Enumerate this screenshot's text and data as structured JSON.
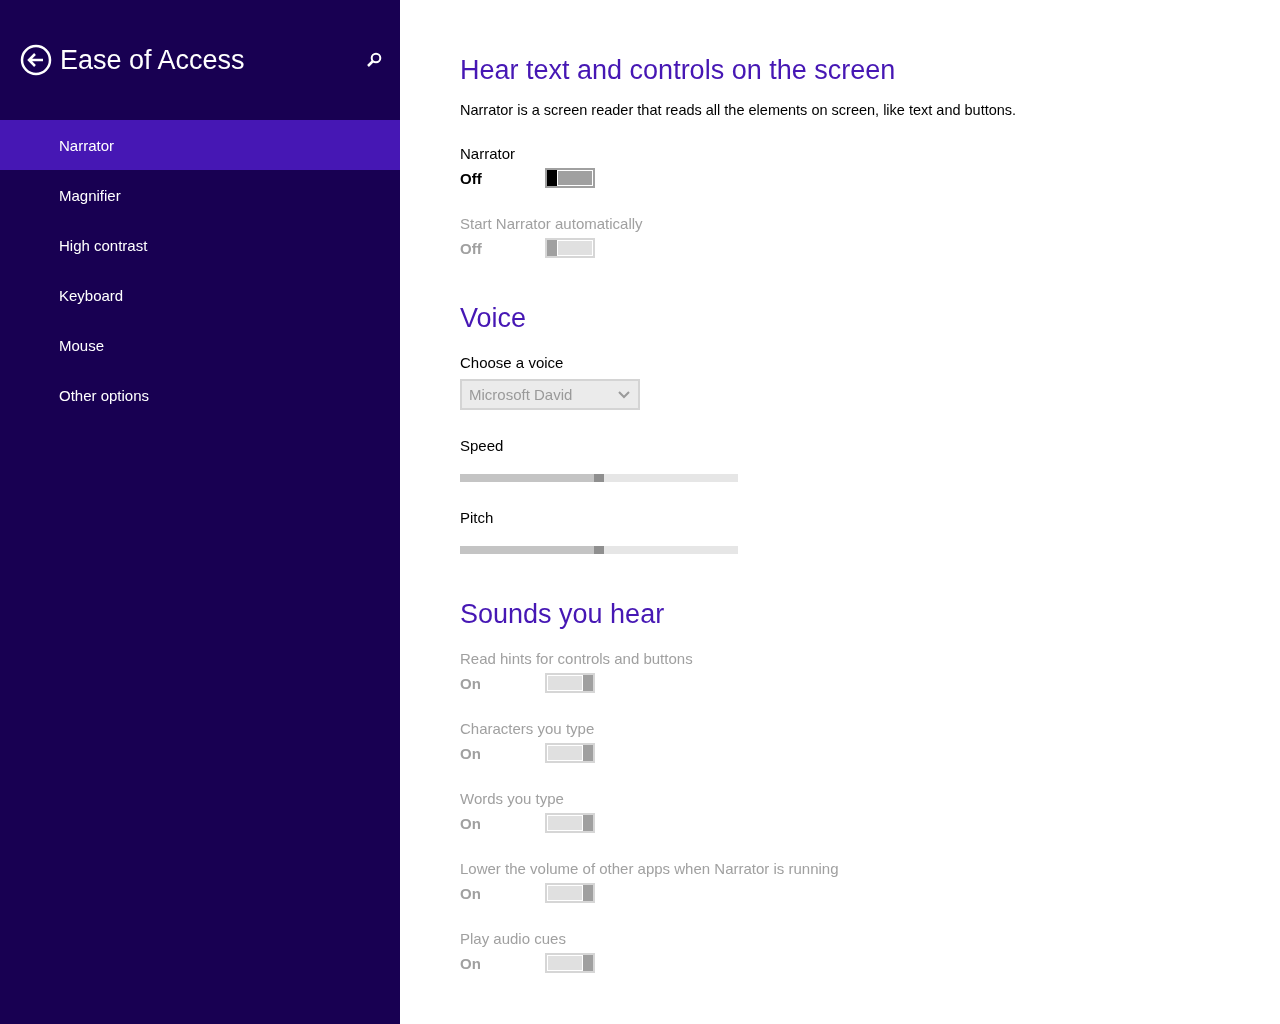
{
  "sidebar": {
    "title": "Ease of Access",
    "items": [
      {
        "label": "Narrator",
        "selected": true
      },
      {
        "label": "Magnifier",
        "selected": false
      },
      {
        "label": "High contrast",
        "selected": false
      },
      {
        "label": "Keyboard",
        "selected": false
      },
      {
        "label": "Mouse",
        "selected": false
      },
      {
        "label": "Other options",
        "selected": false
      }
    ]
  },
  "sections": [
    {
      "heading": "Hear text and controls on the screen",
      "description": "Narrator is a screen reader that reads all the elements on screen, like text and buttons.",
      "items": [
        {
          "kind": "toggle",
          "label": "Narrator",
          "state": "Off",
          "on": false,
          "disabled": false
        },
        {
          "kind": "toggle",
          "label": "Start Narrator automatically",
          "state": "Off",
          "on": false,
          "disabled": true
        }
      ]
    },
    {
      "heading": "Voice",
      "items": [
        {
          "kind": "dropdown",
          "label": "Choose a voice",
          "value": "Microsoft David",
          "disabled": true
        },
        {
          "kind": "slider",
          "label": "Speed",
          "level": 0.5
        },
        {
          "kind": "slider",
          "label": "Pitch",
          "level": 0.5
        }
      ]
    },
    {
      "heading": "Sounds you hear",
      "items": [
        {
          "kind": "toggle",
          "label": "Read hints for controls and buttons",
          "state": "On",
          "on": true,
          "disabled": true
        },
        {
          "kind": "toggle",
          "label": "Characters you type",
          "state": "On",
          "on": true,
          "disabled": true
        },
        {
          "kind": "toggle",
          "label": "Words you type",
          "state": "On",
          "on": true,
          "disabled": true
        },
        {
          "kind": "toggle",
          "label": "Lower the volume of other apps when Narrator is running",
          "state": "On",
          "on": true,
          "disabled": true
        },
        {
          "kind": "toggle",
          "label": "Play audio cues",
          "state": "On",
          "on": true,
          "disabled": true
        }
      ]
    }
  ]
}
